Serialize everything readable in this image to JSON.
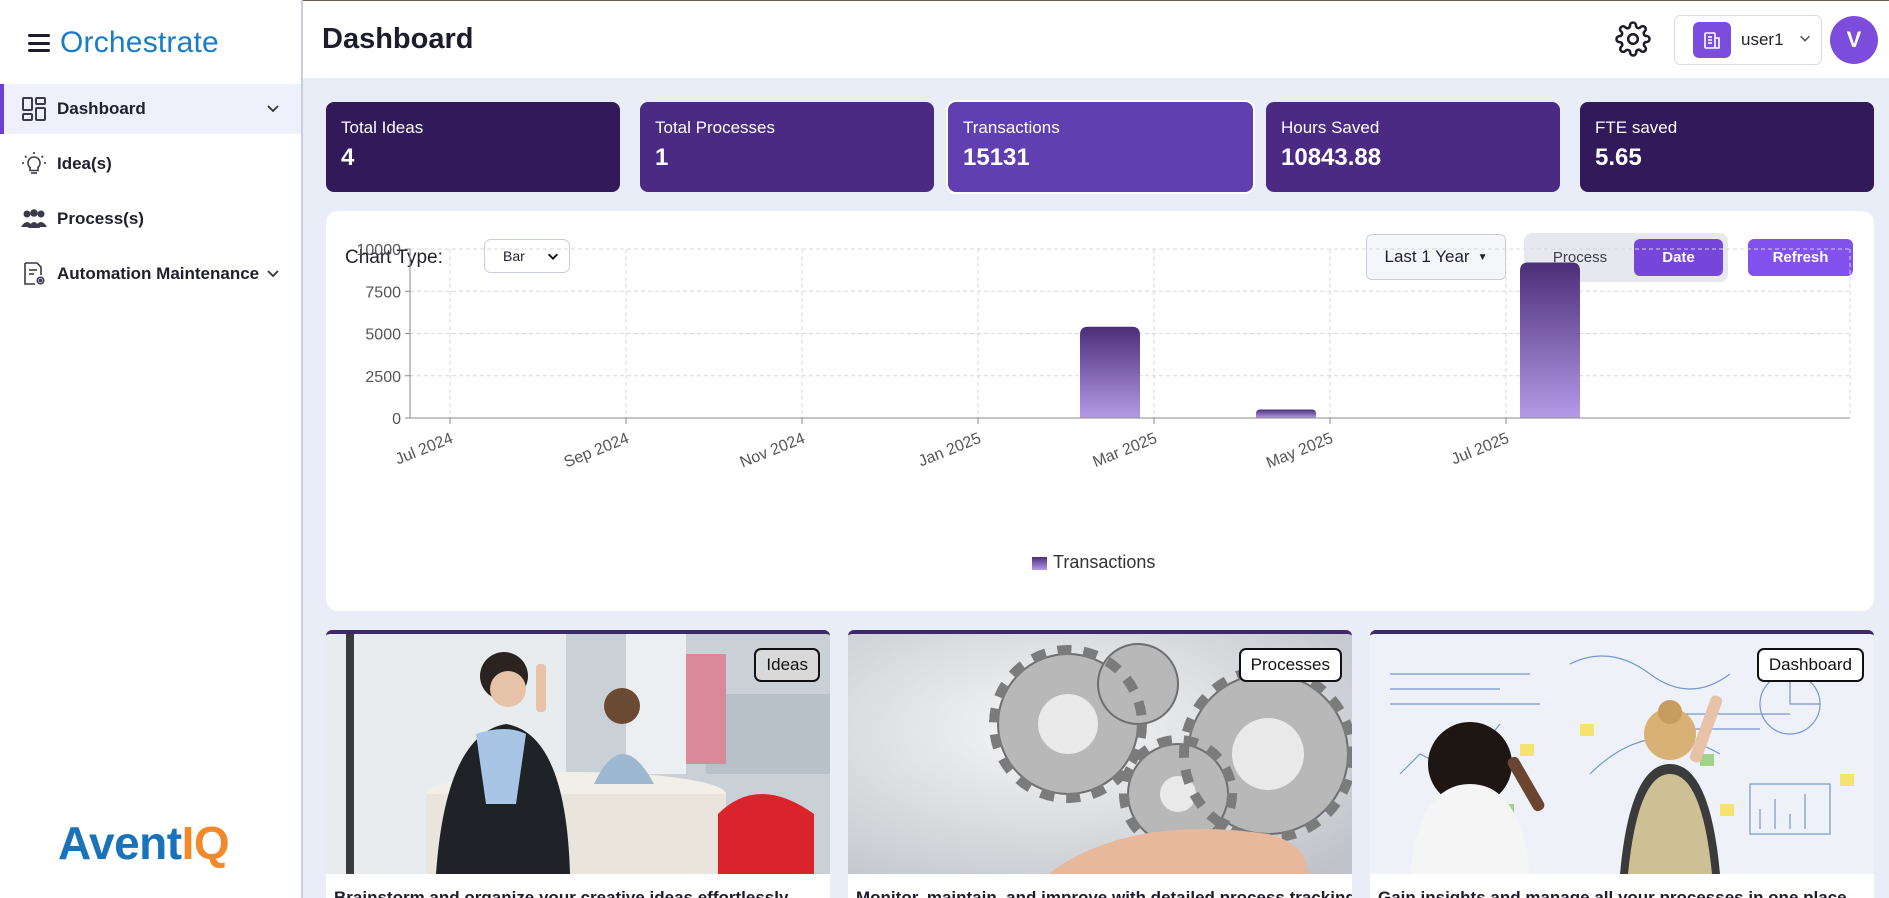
{
  "brand": {
    "name": "Orchestrate",
    "footer_logo_a": "Avent",
    "footer_logo_b": "IQ"
  },
  "sidebar": {
    "items": [
      {
        "label": "Dashboard",
        "icon": "dashboard-grid-icon",
        "active": true,
        "has_chevron": true
      },
      {
        "label": "Idea(s)",
        "icon": "lightbulb-icon",
        "active": false,
        "has_chevron": false
      },
      {
        "label": "Process(s)",
        "icon": "people-group-icon",
        "active": false,
        "has_chevron": false
      },
      {
        "label": "Automation Maintenance",
        "icon": "document-gear-icon",
        "active": false,
        "has_chevron": true
      }
    ]
  },
  "header": {
    "title": "Dashboard",
    "user": {
      "name": "user1",
      "avatar_initial": "V"
    }
  },
  "stats": [
    {
      "label": "Total Ideas",
      "value": "4",
      "color": "#32195a"
    },
    {
      "label": "Total Processes",
      "value": "1",
      "color": "#4a2a82"
    },
    {
      "label": "Transactions",
      "value": "15131",
      "color": "#6040b0"
    },
    {
      "label": "Hours Saved",
      "value": "10843.88",
      "color": "#4a2a82"
    },
    {
      "label": "FTE saved",
      "value": "5.65",
      "color": "#32195a"
    }
  ],
  "chart_controls": {
    "chart_type_label": "Chart Type:",
    "chart_type_value": "Bar",
    "range_label": "Last 1 Year",
    "toggle_process": "Process",
    "toggle_date": "Date",
    "refresh_label": "Refresh"
  },
  "chart_data": {
    "type": "bar",
    "x_ticks": [
      "Jul 2024",
      "Sep 2024",
      "Nov 2024",
      "Jan 2025",
      "Mar 2025",
      "May 2025",
      "Jul 2025"
    ],
    "bars": [
      {
        "date": "Feb 2025",
        "value": 5400
      },
      {
        "date": "Apr 2025",
        "value": 500
      },
      {
        "date": "Jul 2025",
        "value": 9200
      }
    ],
    "y_ticks": [
      0,
      2500,
      5000,
      7500,
      10000
    ],
    "ylim": [
      0,
      10000
    ],
    "series": [
      {
        "name": "Transactions"
      }
    ],
    "legend_position": "bottom",
    "grid": true,
    "bar_color_top": "#4a2e78",
    "bar_color_bottom": "#b59ae8"
  },
  "features": [
    {
      "badge": "Ideas",
      "caption": "Brainstorm and organize your creative ideas effortlessly"
    },
    {
      "badge": "Processes",
      "caption": "Monitor, maintain, and improve with detailed process tracking"
    },
    {
      "badge": "Dashboard",
      "caption": "Gain insights and manage all your processes in one place"
    }
  ]
}
